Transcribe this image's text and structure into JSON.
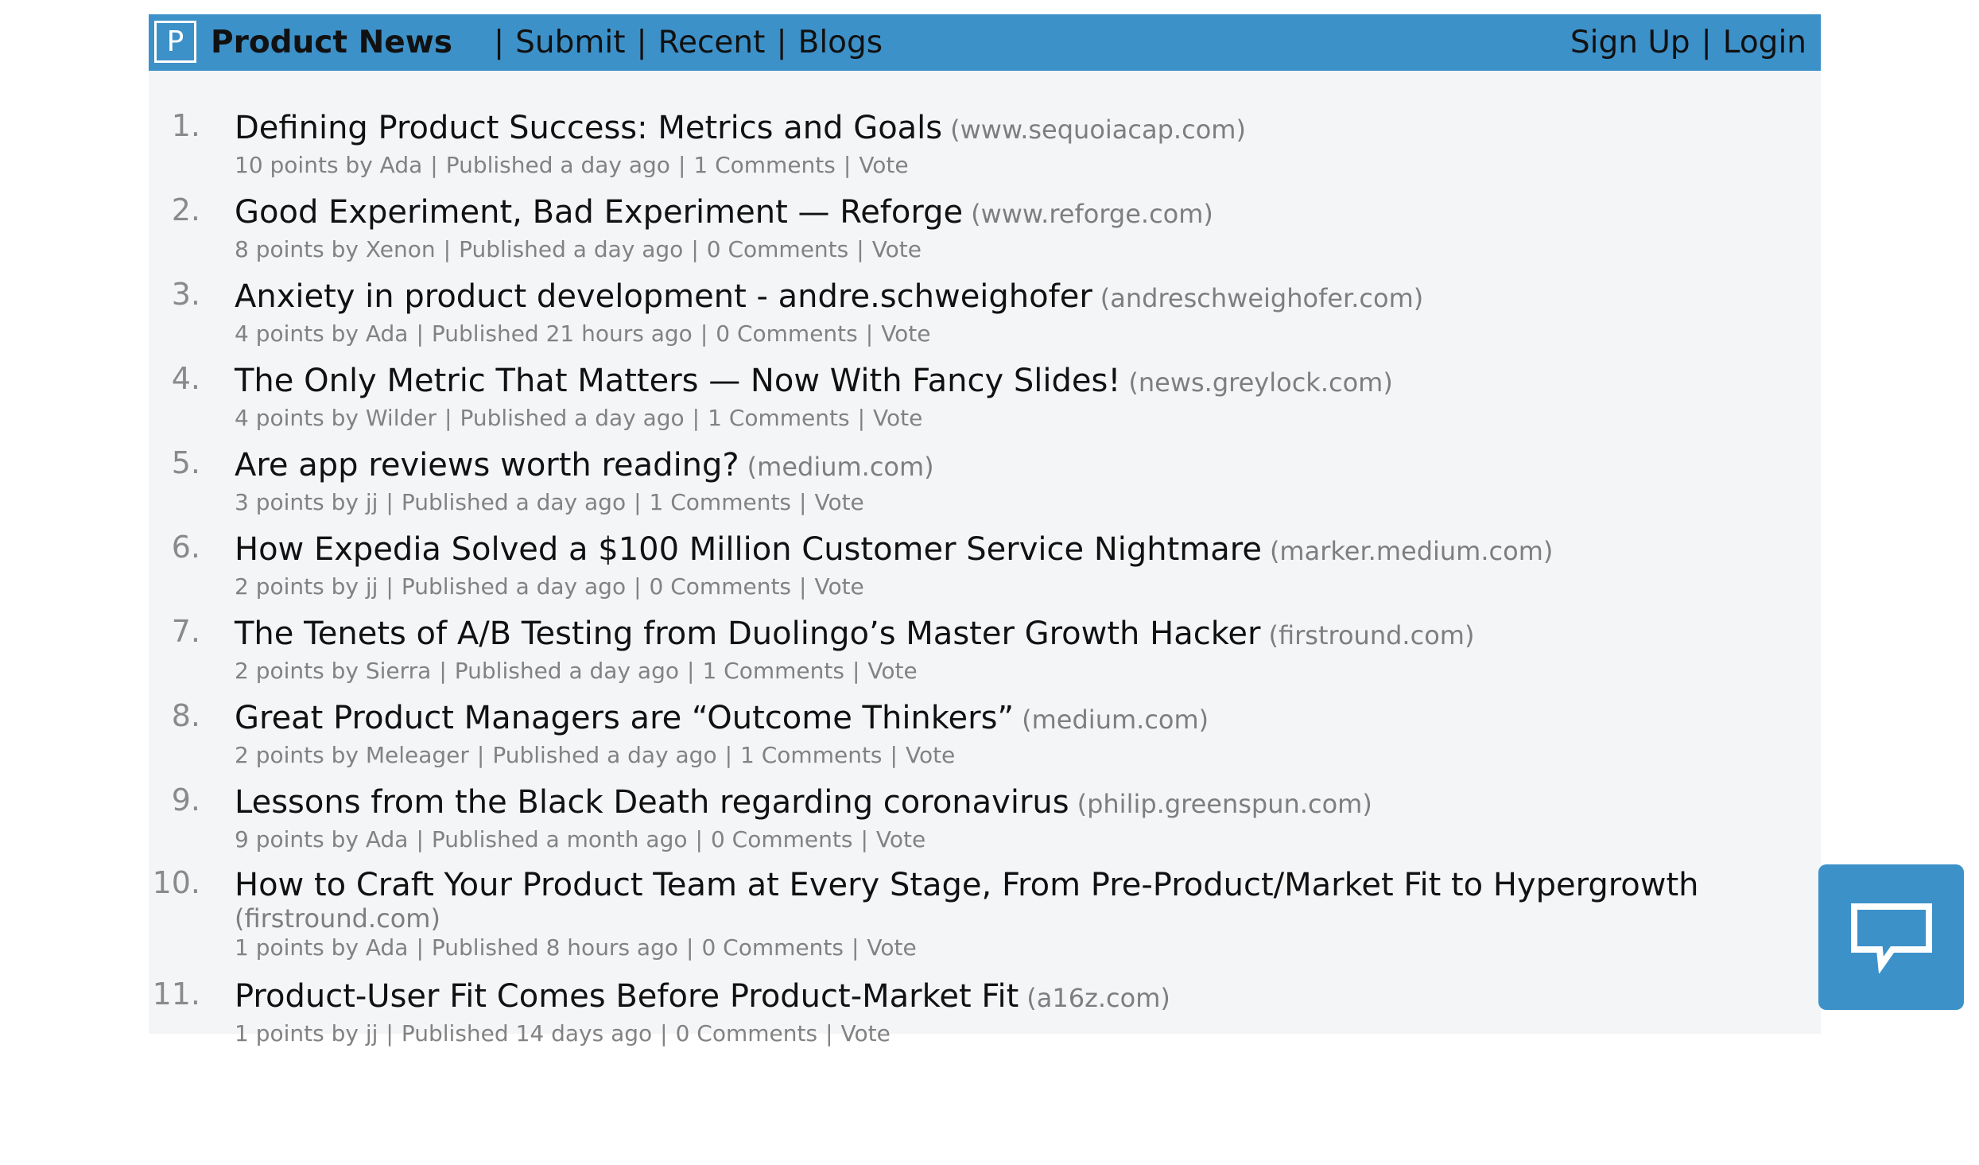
{
  "navbar": {
    "logo_letter": "P",
    "brand": "Product News",
    "links": [
      "Submit",
      "Recent",
      "Blogs"
    ],
    "separator": "|",
    "right_links": [
      "Sign Up",
      "Login"
    ]
  },
  "stories": [
    {
      "rank": "1.",
      "title": "Defining Product Success: Metrics and Goals",
      "domain": "(www.sequoiacap.com)",
      "points": "10 points by Ada",
      "published": "Published a day ago",
      "comments": "1 Comments",
      "vote": "Vote"
    },
    {
      "rank": "2.",
      "title": "Good Experiment, Bad Experiment — Reforge",
      "domain": "(www.reforge.com)",
      "points": "8 points by Xenon",
      "published": "Published a day ago",
      "comments": "0 Comments",
      "vote": "Vote"
    },
    {
      "rank": "3.",
      "title": "Anxiety in product development - andre.schweighofer",
      "domain": "(andreschweighofer.com)",
      "points": "4 points by Ada",
      "published": "Published 21 hours ago",
      "comments": "0 Comments",
      "vote": "Vote"
    },
    {
      "rank": "4.",
      "title": "The Only Metric That Matters — Now With Fancy Slides!",
      "domain": "(news.greylock.com)",
      "points": "4 points by Wilder",
      "published": "Published a day ago",
      "comments": "1 Comments",
      "vote": "Vote"
    },
    {
      "rank": "5.",
      "title": "Are app reviews worth reading?",
      "domain": "(medium.com)",
      "points": "3 points by jj",
      "published": "Published a day ago",
      "comments": "1 Comments",
      "vote": "Vote"
    },
    {
      "rank": "6.",
      "title": "How Expedia Solved a $100 Million Customer Service Nightmare",
      "domain": "(marker.medium.com)",
      "points": "2 points by jj",
      "published": "Published a day ago",
      "comments": "0 Comments",
      "vote": "Vote"
    },
    {
      "rank": "7.",
      "title": "The Tenets of A/B Testing from Duolingo’s Master Growth Hacker",
      "domain": "(firstround.com)",
      "points": "2 points by Sierra",
      "published": "Published a day ago",
      "comments": "1 Comments",
      "vote": "Vote"
    },
    {
      "rank": "8.",
      "title": "Great Product Managers are “Outcome Thinkers”",
      "domain": "(medium.com)",
      "points": "2 points by Meleager",
      "published": "Published a day ago",
      "comments": "1 Comments",
      "vote": "Vote"
    },
    {
      "rank": "9.",
      "title": "Lessons from the Black Death regarding coronavirus",
      "domain": "(philip.greenspun.com)",
      "points": "9 points by Ada",
      "published": "Published a month ago",
      "comments": "0 Comments",
      "vote": "Vote"
    },
    {
      "rank": "10.",
      "title": "How to Craft Your Product Team at Every Stage, From Pre-Product/Market Fit to Hypergrowth",
      "domain": "(firstround.com)",
      "points": "1 points by Ada",
      "published": "Published 8 hours ago",
      "comments": "0 Comments",
      "vote": "Vote"
    },
    {
      "rank": "11.",
      "title": "Product-User Fit Comes Before Product-Market Fit",
      "domain": "(a16z.com)",
      "points": "1 points by jj",
      "published": "Published 14 days ago",
      "comments": "0 Comments",
      "vote": "Vote"
    }
  ],
  "meta_separator": "|",
  "chat_widget": {
    "icon": "chat-bubble-icon"
  },
  "colors": {
    "navbar": "#3d91c9",
    "page_bg": "#f4f5f7",
    "meta_text": "#828282"
  }
}
